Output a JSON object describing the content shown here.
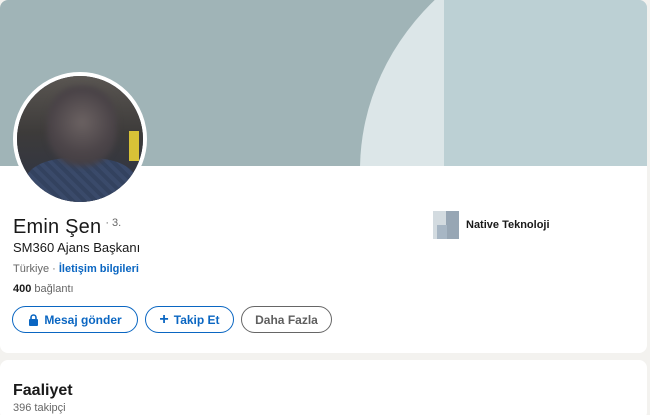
{
  "profile": {
    "name": "Emin Şen",
    "degree": "· 3.",
    "headline": "SM360 Ajans Başkanı",
    "location": "Türkiye · ",
    "contact_link": "İletişim bilgileri",
    "connections_count": "400",
    "connections_label": " bağlantı"
  },
  "company": {
    "name": "Native Teknoloji",
    "logo_icon": "company-logo-icon"
  },
  "actions": {
    "message_label": "Mesaj gönder",
    "message_icon": "lock-icon",
    "follow_label": "Takip Et",
    "follow_icon": "plus-icon",
    "more_label": "Daha Fazla"
  },
  "activity": {
    "title": "Faaliyet",
    "followers": "396 takipçi"
  },
  "colors": {
    "accent": "#0a66c2",
    "cover": "#a0b4b7",
    "page_background": "#f3f2ef"
  }
}
